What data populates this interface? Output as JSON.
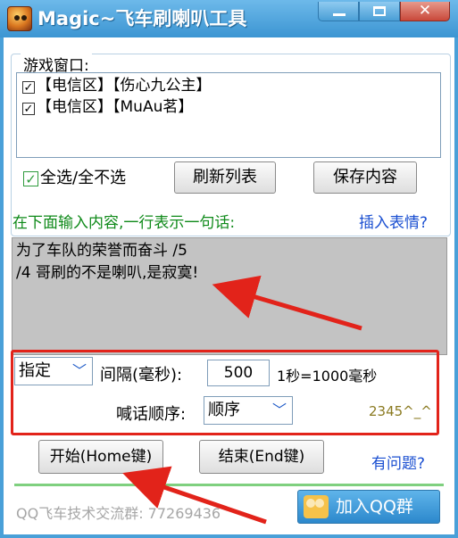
{
  "window": {
    "title": "Magic~飞车刷喇叭工具",
    "min_icon": "minimize-icon",
    "max_icon": "maximize-icon",
    "close_icon": "close-icon"
  },
  "game_group": {
    "label": "游戏窗口:",
    "items": [
      {
        "label": "【电信区】【伤心九公主】",
        "checked": true
      },
      {
        "label": "【电信区】【MuAu茗】",
        "checked": true
      }
    ],
    "select_all_label": "全选/全不选",
    "select_all_checked": true,
    "refresh_button": "刷新列表",
    "save_button": "保存内容"
  },
  "message": {
    "hint": "在下面输入内容,一行表示一句话:",
    "insert_emoji_link": "插入表情?",
    "lines": [
      "为了车队的荣誉而奋斗 /5",
      "/4 哥刷的不是喇叭,是寂寞!"
    ]
  },
  "settings": {
    "mode_value": "指定",
    "interval_label": "间隔(毫秒):",
    "interval_value": "500",
    "interval_note": "1秒=1000毫秒",
    "order_label": "喊话顺序:",
    "order_value": "顺序",
    "small_note": "2345^_^"
  },
  "actions": {
    "start_button": "开始(Home键)",
    "stop_button": "结束(End键)",
    "help_link": "有问题?"
  },
  "footer": {
    "qq_group_text": "QQ飞车技术交流群: 77269436",
    "join_qq_button": "加入QQ群"
  },
  "colors": {
    "title_bar": "#4aa0d8",
    "hint_green": "#0f8a1a",
    "link_blue": "#1a4fd1",
    "highlight_red": "#e2231a"
  }
}
